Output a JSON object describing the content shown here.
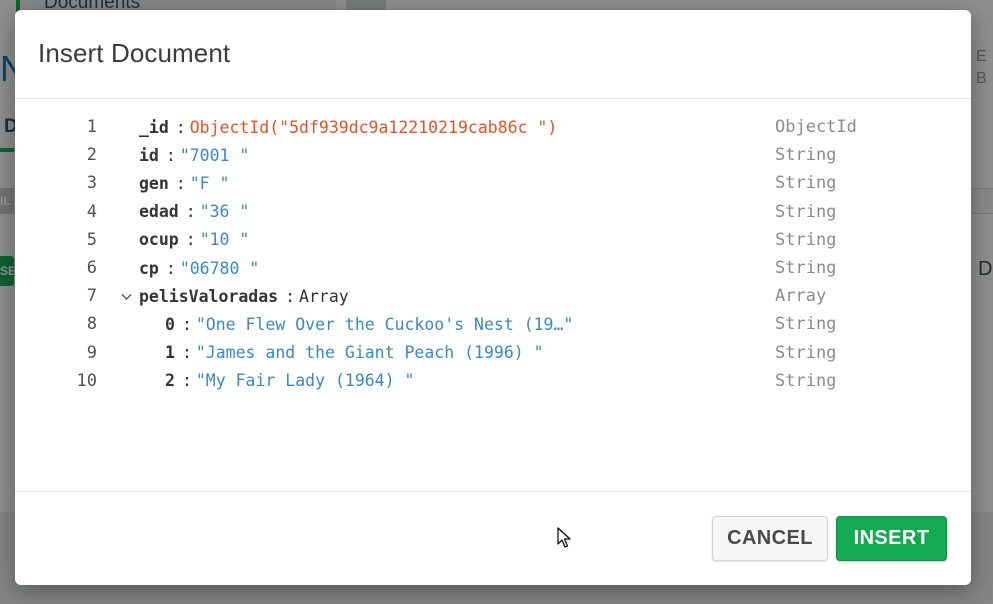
{
  "background": {
    "tab_label": "Documents",
    "left_tab_label": "D",
    "left_button_1": "IL",
    "left_button_2": "SE",
    "right_text_1": "E",
    "right_text_2": "B",
    "right_d": "D"
  },
  "modal": {
    "title": "Insert Document",
    "rows": [
      {
        "line": "1",
        "key": "_id",
        "value": "ObjectId(\"5df939dc9a12210219cab86c \")",
        "value_kind": "oid",
        "type": "ObjectId"
      },
      {
        "line": "2",
        "key": "id",
        "value": "\"7001 \"",
        "value_kind": "string",
        "type": "String"
      },
      {
        "line": "3",
        "key": "gen",
        "value": "\"F \"",
        "value_kind": "string",
        "type": "String"
      },
      {
        "line": "4",
        "key": "edad",
        "value": "\"36 \"",
        "value_kind": "string",
        "type": "String"
      },
      {
        "line": "5",
        "key": "ocup",
        "value": "\"10 \"",
        "value_kind": "string",
        "type": "String"
      },
      {
        "line": "6",
        "key": "cp",
        "value": "\"06780 \"",
        "value_kind": "string",
        "type": "String"
      },
      {
        "line": "7",
        "key": "pelisValoradas",
        "value": "Array",
        "value_kind": "array",
        "type": "Array",
        "expandable": true
      },
      {
        "line": "8",
        "key": "0",
        "value": "\"One Flew Over the Cuckoo's Nest (19…\"",
        "value_kind": "string",
        "type": "String",
        "nested": true
      },
      {
        "line": "9",
        "key": "1",
        "value": "\"James and the Giant Peach (1996) \"",
        "value_kind": "string",
        "type": "String",
        "nested": true
      },
      {
        "line": "10",
        "key": "2",
        "value": "\"My Fair Lady (1964) \"",
        "value_kind": "string",
        "type": "String",
        "nested": true
      }
    ],
    "cancel_label": "CANCEL",
    "insert_label": "INSERT"
  },
  "colors": {
    "accent_green": "#13aa52",
    "string_blue": "#3a88c5",
    "objectid_orange": "#e6521f"
  },
  "icons": {
    "expand_toggle": "chevron-down-icon",
    "cursor": "mouse-pointer-icon"
  }
}
